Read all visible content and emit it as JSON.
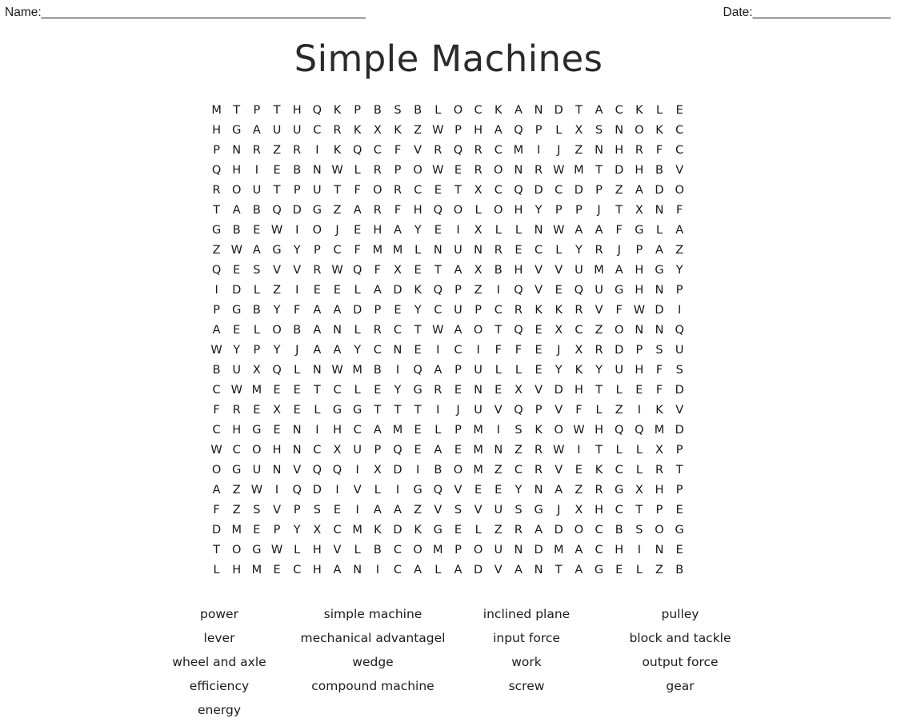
{
  "header": {
    "name_label": "Name:",
    "name_rule": "_______________________________________________",
    "date_label": "Date:",
    "date_rule": "____________________"
  },
  "title": "Simple Machines",
  "grid": {
    "rows": 24,
    "cols": 24,
    "letters": [
      [
        "M",
        "T",
        "P",
        "T",
        "H",
        "Q",
        "K",
        "P",
        "B",
        "S",
        "B",
        "L",
        "O",
        "C",
        "K",
        "A",
        "N",
        "D",
        "T",
        "A",
        "C",
        "K",
        "L",
        "E"
      ],
      [
        "H",
        "G",
        "A",
        "U",
        "U",
        "C",
        "R",
        "K",
        "X",
        "K",
        "Z",
        "W",
        "P",
        "H",
        "A",
        "Q",
        "P",
        "L",
        "X",
        "S",
        "N",
        "O",
        "K",
        "C"
      ],
      [
        "P",
        "N",
        "R",
        "Z",
        "R",
        "I",
        "K",
        "Q",
        "C",
        "F",
        "V",
        "R",
        "Q",
        "R",
        "C",
        "M",
        "I",
        "J",
        "Z",
        "N",
        "H",
        "R",
        "F",
        "C"
      ],
      [
        "Q",
        "H",
        "I",
        "E",
        "B",
        "N",
        "W",
        "L",
        "R",
        "P",
        "O",
        "W",
        "E",
        "R",
        "O",
        "N",
        "R",
        "W",
        "M",
        "T",
        "D",
        "H",
        "B",
        "V"
      ],
      [
        "R",
        "O",
        "U",
        "T",
        "P",
        "U",
        "T",
        "F",
        "O",
        "R",
        "C",
        "E",
        "T",
        "X",
        "C",
        "Q",
        "D",
        "C",
        "D",
        "P",
        "Z",
        "A",
        "D",
        "O"
      ],
      [
        "T",
        "A",
        "B",
        "Q",
        "D",
        "G",
        "Z",
        "A",
        "R",
        "F",
        "H",
        "Q",
        "O",
        "L",
        "O",
        "H",
        "Y",
        "P",
        "P",
        "J",
        "T",
        "X",
        "N",
        "F"
      ],
      [
        "G",
        "B",
        "E",
        "W",
        "I",
        "O",
        "J",
        "E",
        "H",
        "A",
        "Y",
        "E",
        "I",
        "X",
        "L",
        "L",
        "N",
        "W",
        "A",
        "A",
        "F",
        "G",
        "L",
        "A"
      ],
      [
        "Z",
        "W",
        "A",
        "G",
        "Y",
        "P",
        "C",
        "F",
        "M",
        "M",
        "L",
        "N",
        "U",
        "N",
        "R",
        "E",
        "C",
        "L",
        "Y",
        "R",
        "J",
        "P",
        "A",
        "Z"
      ],
      [
        "Q",
        "E",
        "S",
        "V",
        "V",
        "R",
        "W",
        "Q",
        "F",
        "X",
        "E",
        "T",
        "A",
        "X",
        "B",
        "H",
        "V",
        "V",
        "U",
        "M",
        "A",
        "H",
        "G",
        "Y"
      ],
      [
        "I",
        "D",
        "L",
        "Z",
        "I",
        "E",
        "E",
        "L",
        "A",
        "D",
        "K",
        "Q",
        "P",
        "Z",
        "I",
        "Q",
        "V",
        "E",
        "Q",
        "U",
        "G",
        "H",
        "N",
        "P"
      ],
      [
        "P",
        "G",
        "B",
        "Y",
        "F",
        "A",
        "A",
        "D",
        "P",
        "E",
        "Y",
        "C",
        "U",
        "P",
        "C",
        "R",
        "K",
        "K",
        "R",
        "V",
        "F",
        "W",
        "D",
        "I"
      ],
      [
        "A",
        "E",
        "L",
        "O",
        "B",
        "A",
        "N",
        "L",
        "R",
        "C",
        "T",
        "W",
        "A",
        "O",
        "T",
        "Q",
        "E",
        "X",
        "C",
        "Z",
        "O",
        "N",
        "N",
        "Q"
      ],
      [
        "W",
        "Y",
        "P",
        "Y",
        "J",
        "A",
        "A",
        "Y",
        "C",
        "N",
        "E",
        "I",
        "C",
        "I",
        "F",
        "F",
        "E",
        "J",
        "X",
        "R",
        "D",
        "P",
        "S",
        "U"
      ],
      [
        "B",
        "U",
        "X",
        "Q",
        "L",
        "N",
        "W",
        "M",
        "B",
        "I",
        "Q",
        "A",
        "P",
        "U",
        "L",
        "L",
        "E",
        "Y",
        "K",
        "Y",
        "U",
        "H",
        "F",
        "S"
      ],
      [
        "C",
        "W",
        "M",
        "E",
        "E",
        "T",
        "C",
        "L",
        "E",
        "Y",
        "G",
        "R",
        "E",
        "N",
        "E",
        "X",
        "V",
        "D",
        "H",
        "T",
        "L",
        "E",
        "F",
        "D"
      ],
      [
        "F",
        "R",
        "E",
        "X",
        "E",
        "L",
        "G",
        "G",
        "T",
        "T",
        "T",
        "I",
        "J",
        "U",
        "V",
        "Q",
        "P",
        "V",
        "F",
        "L",
        "Z",
        "I",
        "K",
        "V"
      ],
      [
        "C",
        "H",
        "G",
        "E",
        "N",
        "I",
        "H",
        "C",
        "A",
        "M",
        "E",
        "L",
        "P",
        "M",
        "I",
        "S",
        "K",
        "O",
        "W",
        "H",
        "Q",
        "Q",
        "M",
        "D"
      ],
      [
        "W",
        "C",
        "O",
        "H",
        "N",
        "C",
        "X",
        "U",
        "P",
        "Q",
        "E",
        "A",
        "E",
        "M",
        "N",
        "Z",
        "R",
        "W",
        "I",
        "T",
        "L",
        "L",
        "X",
        "P"
      ],
      [
        "O",
        "G",
        "U",
        "N",
        "V",
        "Q",
        "Q",
        "I",
        "X",
        "D",
        "I",
        "B",
        "O",
        "M",
        "Z",
        "C",
        "R",
        "V",
        "E",
        "K",
        "C",
        "L",
        "R",
        "T"
      ],
      [
        "A",
        "Z",
        "W",
        "I",
        "Q",
        "D",
        "I",
        "V",
        "L",
        "I",
        "G",
        "Q",
        "V",
        "E",
        "E",
        "Y",
        "N",
        "A",
        "Z",
        "R",
        "G",
        "X",
        "H",
        "P"
      ],
      [
        "F",
        "Z",
        "S",
        "V",
        "P",
        "S",
        "E",
        "I",
        "A",
        "A",
        "Z",
        "V",
        "S",
        "V",
        "U",
        "S",
        "G",
        "J",
        "X",
        "H",
        "C",
        "T",
        "P",
        "E"
      ],
      [
        "D",
        "M",
        "E",
        "P",
        "Y",
        "X",
        "C",
        "M",
        "K",
        "D",
        "K",
        "G",
        "E",
        "L",
        "Z",
        "R",
        "A",
        "D",
        "O",
        "C",
        "B",
        "S",
        "O",
        "G"
      ],
      [
        "T",
        "O",
        "G",
        "W",
        "L",
        "H",
        "V",
        "L",
        "B",
        "C",
        "O",
        "M",
        "P",
        "O",
        "U",
        "N",
        "D",
        "M",
        "A",
        "C",
        "H",
        "I",
        "N",
        "E"
      ],
      [
        "L",
        "H",
        "M",
        "E",
        "C",
        "H",
        "A",
        "N",
        "I",
        "C",
        "A",
        "L",
        "A",
        "D",
        "V",
        "A",
        "N",
        "T",
        "A",
        "G",
        "E",
        "L",
        "Z",
        "B"
      ]
    ]
  },
  "word_list": {
    "rows": [
      [
        "power",
        "simple machine",
        "inclined plane",
        "pulley"
      ],
      [
        "lever",
        "mechanical advantagel",
        "input force",
        "block and tackle"
      ],
      [
        "wheel and axle",
        "wedge",
        "work",
        "output force"
      ],
      [
        "efficiency",
        "compound machine",
        "screw",
        "gear"
      ],
      [
        "energy",
        "",
        "",
        ""
      ]
    ]
  },
  "colors": {
    "page_background": "#ffffff",
    "text": "#1a1a1a",
    "title_text": "#2b2b2b",
    "grid_letter": "#161616"
  }
}
